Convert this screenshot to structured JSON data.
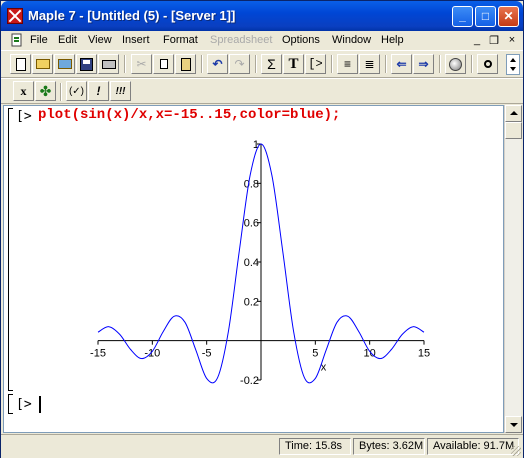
{
  "window": {
    "title": "Maple 7  - [Untitled (5) - [Server 1]]",
    "title_bar_color": "#0a46d5",
    "controls": {
      "minimize": "_",
      "maximize": "□",
      "close": "✕"
    }
  },
  "menu": {
    "items": [
      {
        "label": "File",
        "enabled": true
      },
      {
        "label": "Edit",
        "enabled": true
      },
      {
        "label": "View",
        "enabled": true
      },
      {
        "label": "Insert",
        "enabled": true
      },
      {
        "label": "Format",
        "enabled": true
      },
      {
        "label": "Spreadsheet",
        "enabled": false
      },
      {
        "label": "Options",
        "enabled": true
      },
      {
        "label": "Window",
        "enabled": true
      },
      {
        "label": "Help",
        "enabled": true
      }
    ],
    "doc_controls": {
      "minimize": "_",
      "restore": "❐",
      "close": "×"
    }
  },
  "toolbar": {
    "main_buttons": [
      "new-document-icon",
      "open-folder-icon",
      "open-url-icon",
      "save-icon",
      "print-icon",
      "cut-icon",
      "copy-icon",
      "paste-icon",
      "undo-icon",
      "redo-icon",
      "sigma-icon",
      "text-T-icon",
      "prompt-icon",
      "indent-icon",
      "outdent-icon",
      "back-arrow-icon",
      "forward-arrow-icon",
      "stop-icon",
      "zoom-icon"
    ],
    "glyphs": {
      "sigma": "Σ",
      "text": "T",
      "prompt": "[>",
      "back": "⇐",
      "forward": "⇒",
      "undo": "↶",
      "redo": "↷"
    },
    "context_buttons": [
      {
        "name": "maple-x-icon",
        "glyph": "x"
      },
      {
        "name": "maple-leaf-icon",
        "glyph": "✤"
      },
      {
        "name": "eval-check-icon",
        "glyph": "(✓)"
      },
      {
        "name": "execute-icon",
        "glyph": "!"
      },
      {
        "name": "execute-all-icon",
        "glyph": "!!!"
      }
    ]
  },
  "worksheet": {
    "prompt1": "[>",
    "command": "plot(sin(x)/x,x=-15..15,color=blue);",
    "command_color": "#e00000",
    "prompt2": "[>"
  },
  "chart_data": {
    "type": "line",
    "function": "sin(x)/x",
    "xlabel": "x",
    "ylabel": "",
    "xlim": [
      -15,
      15
    ],
    "ylim": [
      -0.2,
      1
    ],
    "x_ticks": [
      -15,
      -10,
      -5,
      5,
      10,
      15
    ],
    "y_ticks": [
      -0.2,
      0.2,
      0.4,
      0.6,
      0.8,
      1
    ],
    "x_tick_labels": [
      "-15",
      "-10",
      "-5",
      "5",
      "10",
      "15"
    ],
    "y_tick_labels": [
      "-0.2",
      "0.2",
      "0.4",
      "0.6",
      "0.8",
      "1"
    ],
    "color": "#0000ff",
    "series": [
      {
        "name": "",
        "x": [
          -15,
          -14,
          -13,
          -12,
          -11,
          -10,
          -9,
          -8,
          -7,
          -6,
          -5,
          -4,
          -3,
          -2,
          -1,
          0,
          1,
          2,
          3,
          4,
          5,
          6,
          7,
          8,
          9,
          10,
          11,
          12,
          13,
          14,
          15
        ],
        "values": [
          0.043,
          0.071,
          0.032,
          -0.045,
          -0.091,
          -0.054,
          0.046,
          0.124,
          0.094,
          -0.047,
          -0.192,
          -0.189,
          0.047,
          0.455,
          0.841,
          1,
          0.841,
          0.455,
          0.047,
          -0.189,
          -0.192,
          -0.047,
          0.094,
          0.124,
          0.046,
          -0.054,
          -0.091,
          -0.045,
          0.032,
          0.071,
          0.043
        ]
      }
    ],
    "grid": false
  },
  "status": {
    "time": "Time:  15.8s",
    "bytes": "Bytes: 3.62M",
    "available": "Available: 91.7M"
  }
}
